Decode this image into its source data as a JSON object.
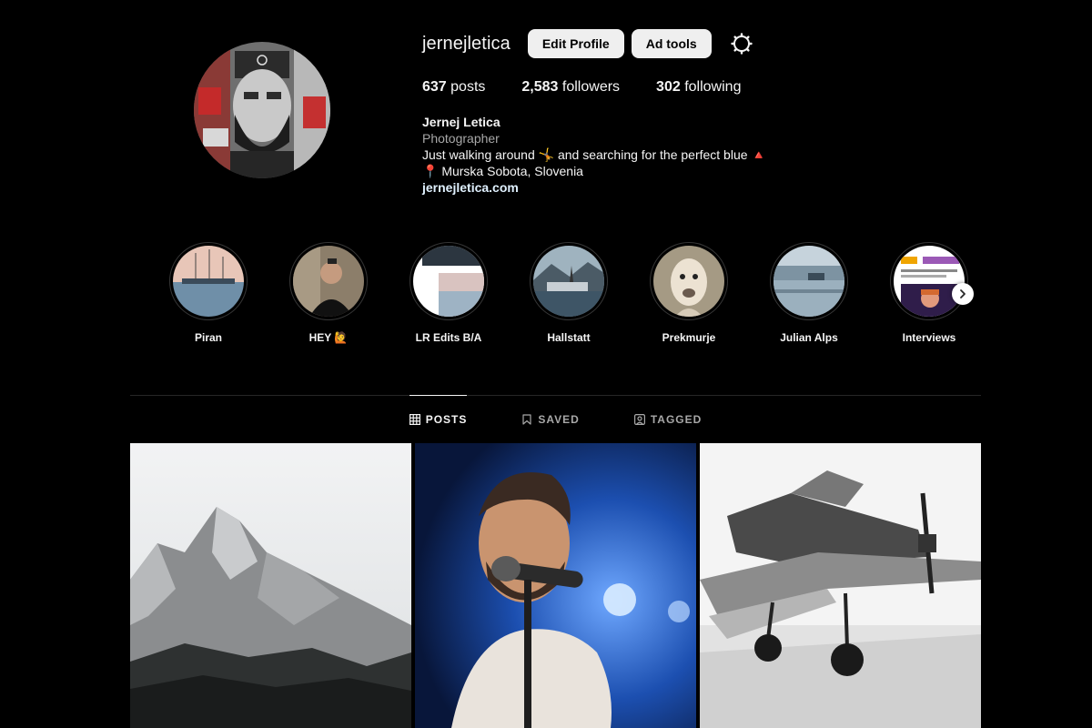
{
  "profile": {
    "username": "jernejletica",
    "edit_profile_label": "Edit Profile",
    "ad_tools_label": "Ad tools",
    "settings_icon": "settings-gear-icon",
    "stats": {
      "posts_count": "637",
      "posts_label": "posts",
      "followers_count": "2,583",
      "followers_label": "followers",
      "following_count": "302",
      "following_label": "following"
    },
    "bio": {
      "full_name": "Jernej Letica",
      "category": "Photographer",
      "line1": "Just walking around 🤸 and searching for the perfect blue 🔺",
      "line2": "📍 Murska Sobota, Slovenia",
      "website": "jernejletica.com"
    }
  },
  "highlights": [
    {
      "label": "Piran"
    },
    {
      "label": "HEY 🙋"
    },
    {
      "label": "LR Edits B/A"
    },
    {
      "label": "Hallstatt"
    },
    {
      "label": "Prekmurje"
    },
    {
      "label": "Julian Alps"
    },
    {
      "label": "Interviews"
    }
  ],
  "tabs": [
    {
      "label": "POSTS",
      "icon": "grid-icon",
      "active": true
    },
    {
      "label": "SAVED",
      "icon": "bookmark-icon",
      "active": false
    },
    {
      "label": "TAGGED",
      "icon": "tagged-user-icon",
      "active": false
    }
  ],
  "posts": [
    {
      "subject": "snowy-mountain-photo"
    },
    {
      "subject": "singer-at-microphone-photo"
    },
    {
      "subject": "propeller-airplane-photo"
    }
  ],
  "colors": {
    "background": "#000000",
    "button_bg": "#efefef",
    "secondary_text": "#a8a8a8",
    "link": "#e0f1ff",
    "divider": "#262626"
  }
}
